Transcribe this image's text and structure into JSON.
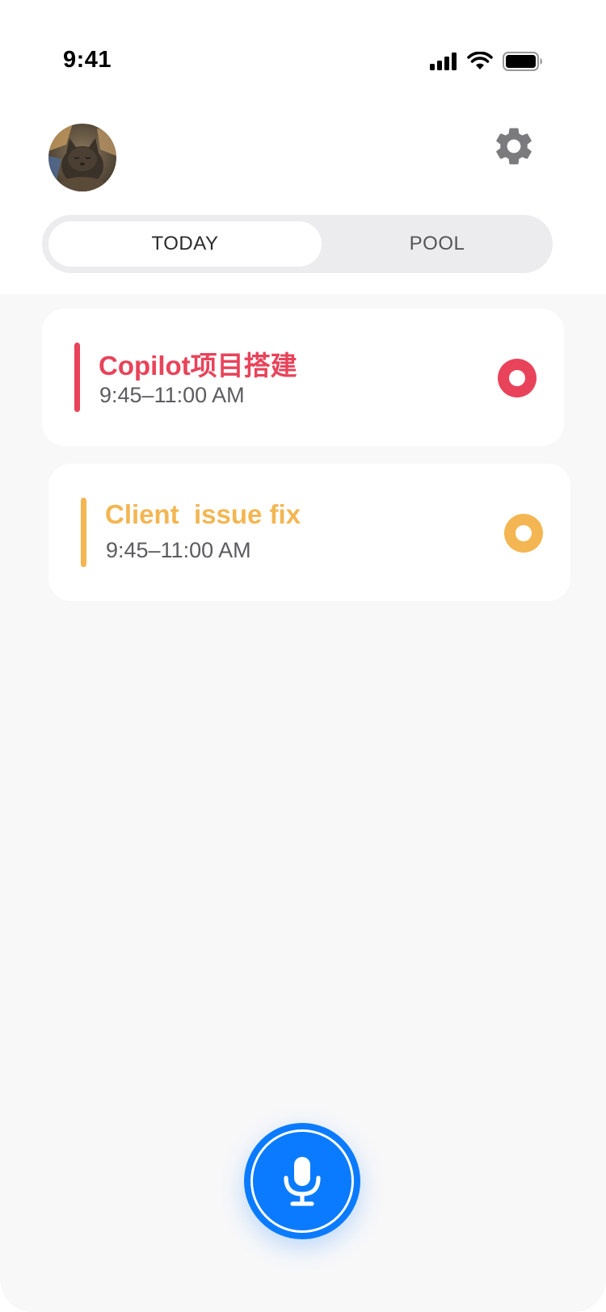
{
  "status_bar": {
    "time": "9:41",
    "icons": [
      "cellular-signal-icon",
      "wifi-icon",
      "battery-icon"
    ]
  },
  "header": {
    "avatar": "cat-avatar",
    "settings_icon": "gear-icon"
  },
  "tabs": [
    {
      "label": "TODAY",
      "selected": true
    },
    {
      "label": "POOL",
      "selected": false
    }
  ],
  "tasks": [
    {
      "title": "Copilot项目搭建",
      "time": "9:45–11:00 AM",
      "color": "#e8435a"
    },
    {
      "title": "Client  issue fix",
      "time": "9:45–11:00 AM",
      "color": "#f3b652"
    }
  ],
  "voice_button": {
    "icon": "microphone-icon",
    "color": "#0a7bff"
  }
}
